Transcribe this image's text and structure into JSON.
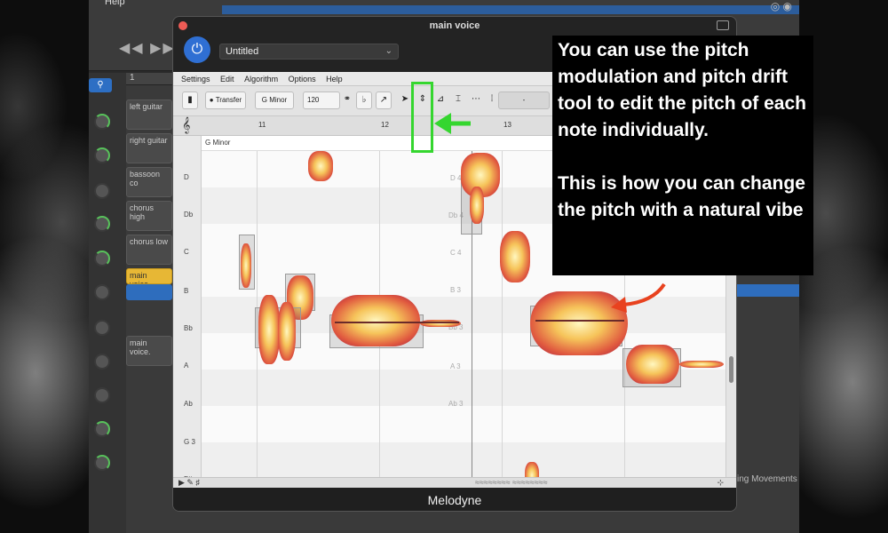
{
  "host": {
    "menu_label": "Help",
    "ruler_bar": "1",
    "tracks": [
      {
        "name": "left guitar"
      },
      {
        "name": "right guitar"
      },
      {
        "name": "bassoon co"
      },
      {
        "name": "chorus high"
      },
      {
        "name": "chorus low"
      },
      {
        "name": "main voice."
      },
      {
        "name": "main voice."
      }
    ],
    "status_text": "ing Movements"
  },
  "plugin": {
    "window_title": "main voice",
    "document_name": "Untitled",
    "app_name": "Melodyne",
    "menu": [
      "Settings",
      "Edit",
      "Algorithm",
      "Options",
      "Help"
    ],
    "toolbar": {
      "transfer_label": "Transfer",
      "key_label": "G Minor",
      "tempo_value": "120",
      "field_value": "-"
    },
    "bar_numbers": [
      "11",
      "12",
      "13"
    ],
    "key_strip": "G Minor",
    "pitch_rows": [
      "D",
      "Db",
      "C",
      "B",
      "Bb",
      "A",
      "Ab",
      "G 3",
      "F#"
    ],
    "ghost_labels": [
      "D 4",
      "Db 4",
      "C 4",
      "B 3",
      "Bb 3",
      "A 3",
      "Ab 3"
    ]
  },
  "annotation": {
    "paragraph_1": "You can use the pitch modulation and pitch drift tool to edit the pitch of each note individually.",
    "paragraph_2": "This is how you can change the pitch with a natural vibe",
    "box_color": "#35d62f",
    "arrow_green": "#35d62f",
    "arrow_red": "#e8421f"
  }
}
